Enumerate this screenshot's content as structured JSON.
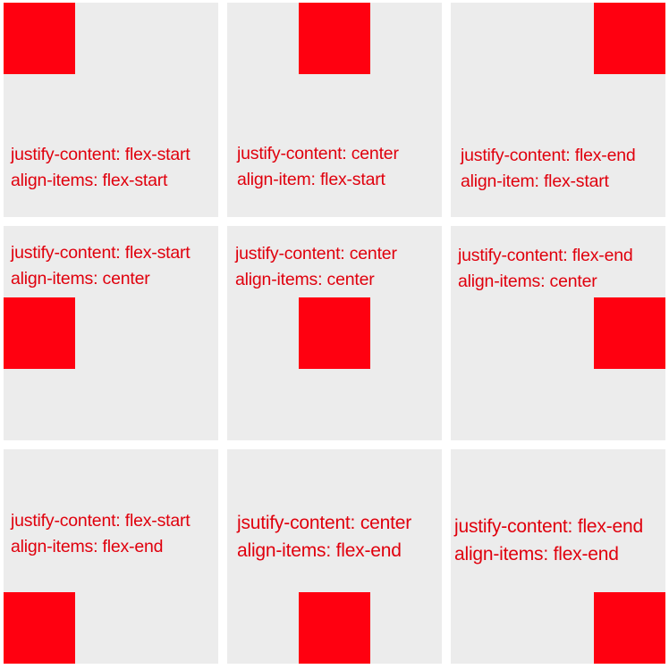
{
  "colors": {
    "cell_background": "#ececec",
    "box": "#ff0010",
    "text": "#e0000d"
  },
  "cells": [
    {
      "line1": "justify-content: flex-start",
      "line2": "align-items: flex-start"
    },
    {
      "line1": "justify-content: center",
      "line2": "align-item: flex-start"
    },
    {
      "line1": "justify-content: flex-end",
      "line2": "align-item: flex-start"
    },
    {
      "line1": "justify-content: flex-start",
      "line2": "align-items: center"
    },
    {
      "line1": "justify-content: center",
      "line2": "align-items: center"
    },
    {
      "line1": "justify-content: flex-end",
      "line2": "align-items: center"
    },
    {
      "line1": "justify-content: flex-start",
      "line2": "align-items: flex-end"
    },
    {
      "line1": "jsutify-content: center",
      "line2": "align-items: flex-end"
    },
    {
      "line1": "justify-content: flex-end",
      "line2": "align-items: flex-end"
    }
  ]
}
